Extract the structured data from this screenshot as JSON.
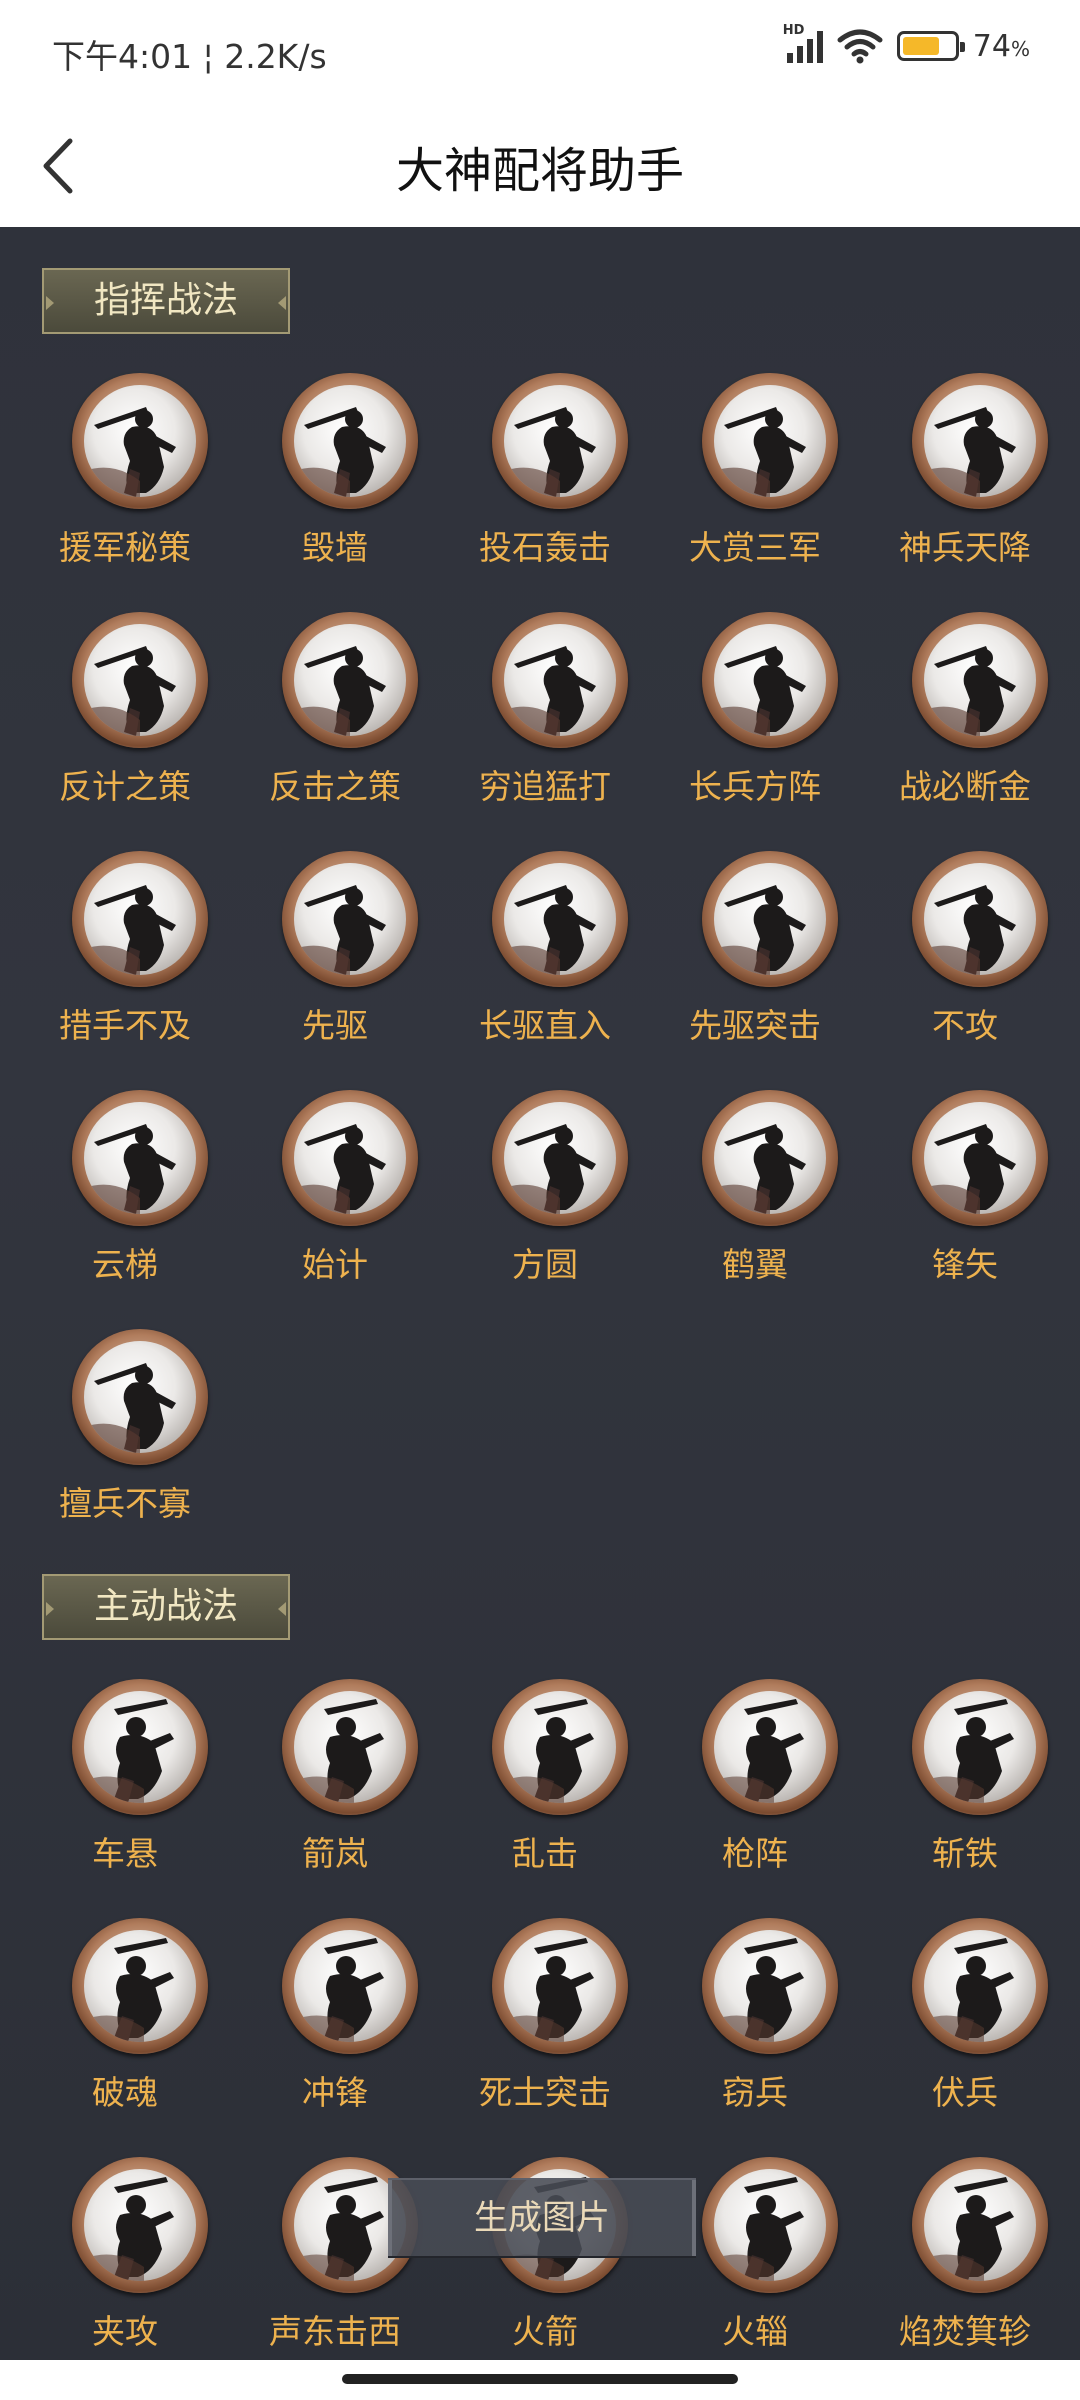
{
  "status_bar": {
    "time_speed": "下午4:01 ¦ 2.2K/s",
    "network_tag": "HD",
    "battery_percent": "74",
    "battery_unit": "%"
  },
  "header": {
    "title": "大神配将助手",
    "back_icon": "chevron-left-icon"
  },
  "sections": [
    {
      "title": "指挥战法",
      "items": [
        "援军秘策",
        "毁墙",
        "投石轰击",
        "大赏三军",
        "神兵天降",
        "反计之策",
        "反击之策",
        "穷追猛打",
        "长兵方阵",
        "战必断金",
        "措手不及",
        "先驱",
        "长驱直入",
        "先驱突击",
        "不攻",
        "云梯",
        "始计",
        "方圆",
        "鹤翼",
        "锋矢",
        "擅兵不寡"
      ]
    },
    {
      "title": "主动战法",
      "items": [
        "车悬",
        "箭岚",
        "乱击",
        "枪阵",
        "斩铁",
        "破魂",
        "冲锋",
        "死士突击",
        "窃兵",
        "伏兵",
        "夹攻",
        "声东击西",
        "火箭",
        "火辎",
        "焰焚箕轸"
      ]
    }
  ],
  "generate_button": "生成图片",
  "colors": {
    "background": "#30333c",
    "label": "#eeb24e",
    "tag_text": "#f1e7c2",
    "battery": "#f5b829"
  }
}
